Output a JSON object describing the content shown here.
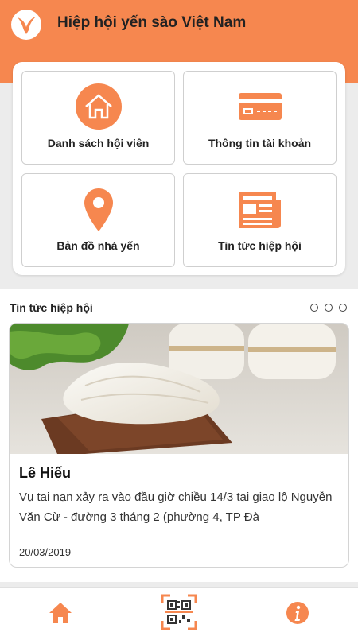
{
  "header": {
    "title": "Hiệp hội yến sào Việt Nam",
    "logo_icon": "swift-bird-logo-icon",
    "background_color": "#f6874f"
  },
  "menu": {
    "items": [
      {
        "label": "Danh sách hội viên",
        "icon": "home-icon"
      },
      {
        "label": "Thông tin tài khoản",
        "icon": "credit-card-icon"
      },
      {
        "label": "Bản đồ nhà yến",
        "icon": "map-pin-icon"
      },
      {
        "label": "Tin tức hiệp hội",
        "icon": "newspaper-icon"
      }
    ],
    "accent_color": "#f6874f"
  },
  "news": {
    "section_title": "Tin tức hiệp hội",
    "carousel_dots": 3,
    "card": {
      "author": "Lê Hiếu",
      "excerpt": "Vụ tai nạn xảy ra vào đầu giờ chiều 14/3 tại giao lộ Nguyễn Văn Cừ - đường 3 tháng 2 (phường 4, TP Đà",
      "date": "20/03/2019"
    }
  },
  "bottom_nav": {
    "items": [
      {
        "icon": "home-icon"
      },
      {
        "icon": "qr-scan-icon"
      },
      {
        "icon": "info-icon"
      }
    ]
  }
}
